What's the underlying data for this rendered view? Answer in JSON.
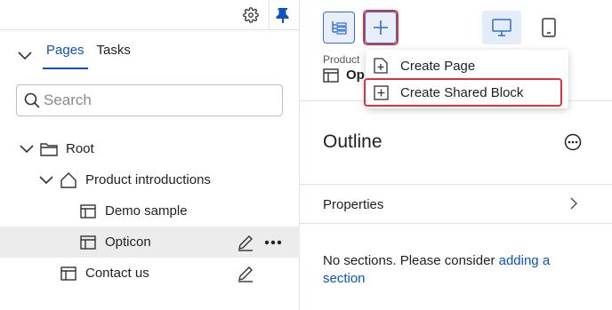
{
  "left_panel": {
    "tabs": [
      {
        "label": "Pages",
        "active": true
      },
      {
        "label": "Tasks",
        "active": false
      }
    ],
    "search": {
      "placeholder": "Search",
      "value": ""
    },
    "tree": [
      {
        "label": "Root",
        "icon": "folder-icon",
        "level": 0,
        "expanded": true
      },
      {
        "label": "Product introductions",
        "icon": "home-icon",
        "level": 1,
        "expanded": true
      },
      {
        "label": "Demo sample",
        "icon": "page-icon",
        "level": 2
      },
      {
        "label": "Opticon",
        "icon": "page-icon",
        "level": 2,
        "selected": true
      },
      {
        "label": "Contact us",
        "icon": "page-icon",
        "level": 1
      }
    ],
    "toolbar_icons": [
      "gear-icon",
      "pin-icon"
    ]
  },
  "right_panel": {
    "breadcrumb_small": "Product",
    "breadcrumb_main": "Op",
    "outline_title": "Outline",
    "properties_label": "Properties",
    "no_sections_text": "No sections. Please consider ",
    "no_sections_link": "adding a section"
  },
  "add_menu": {
    "items": [
      {
        "label": "Create Page",
        "icon": "plus-page-icon"
      },
      {
        "label": "Create Shared Block",
        "icon": "plus-block-icon",
        "highlighted": true
      }
    ]
  },
  "colors": {
    "accent": "#0b53c2",
    "highlight_border": "#d9333f",
    "selected_row": "#ececec"
  }
}
